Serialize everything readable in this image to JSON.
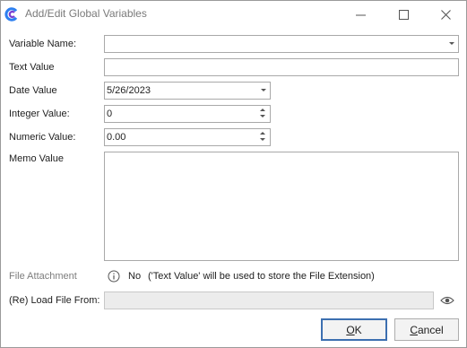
{
  "window": {
    "title": "Add/Edit Global Variables",
    "icons": {
      "app": "app-logo-icon",
      "minimize": "minimize-icon",
      "maximize": "maximize-icon",
      "close": "close-icon"
    }
  },
  "form": {
    "variable_name": {
      "label": "Variable Name:",
      "value": ""
    },
    "text_value": {
      "label": "Text Value",
      "value": ""
    },
    "date_value": {
      "label": "Date Value",
      "value": "5/26/2023"
    },
    "integer_value": {
      "label": "Integer Value:",
      "value": "0"
    },
    "numeric_value": {
      "label": "Numeric Value:",
      "value": "0.00"
    },
    "memo_value": {
      "label": "Memo Value",
      "value": ""
    },
    "file_attachment": {
      "label": "File Attachment",
      "status": "No",
      "note": "('Text Value' will be used to store the File Extension)"
    },
    "reload_file": {
      "label": "(Re) Load File From:",
      "value": ""
    }
  },
  "buttons": {
    "ok": {
      "mnemonic": "O",
      "rest": "K"
    },
    "cancel": {
      "mnemonic": "C",
      "rest": "ancel"
    }
  },
  "colors": {
    "accent": "#3c6fb0",
    "logo_blue": "#2d7ff0",
    "logo_purple": "#7a3fd1"
  }
}
